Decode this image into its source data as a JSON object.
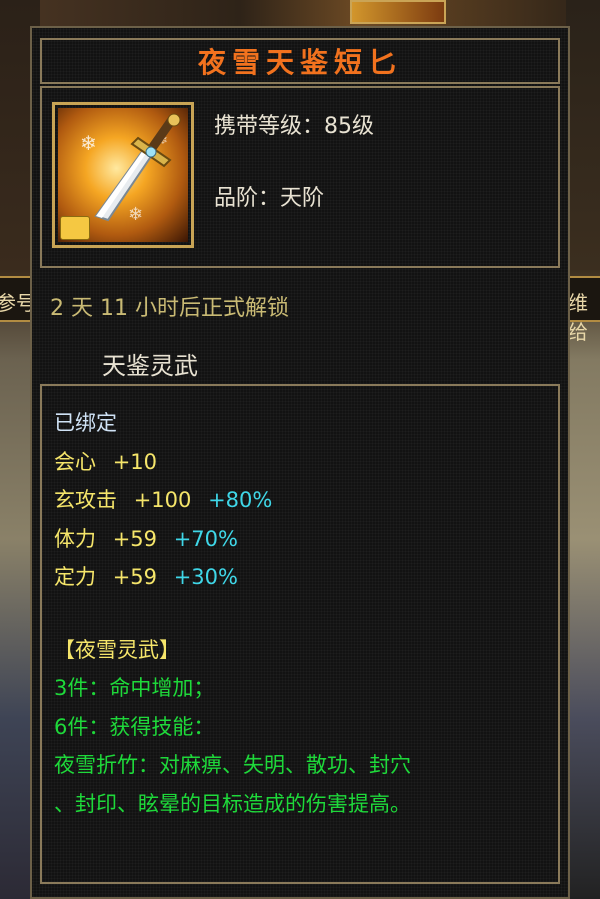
{
  "background": {
    "left_strip_text": "参号",
    "right_strip_text": "维给"
  },
  "item": {
    "name": "夜雪天鉴短匕",
    "icon": "dagger-icon",
    "level_req": "携带等级：85级",
    "grade": "品阶：天阶",
    "unlock": "2 天 11 小时后正式解锁",
    "category": "天鉴灵武"
  },
  "attributes": {
    "bound": "已绑定",
    "stats": [
      {
        "name": "会心",
        "base": "+10",
        "bonus": ""
      },
      {
        "name": "玄攻击",
        "base": "+100",
        "bonus": "+80%"
      },
      {
        "name": "体力",
        "base": "+59",
        "bonus": "+70%"
      },
      {
        "name": "定力",
        "base": "+59",
        "bonus": "+30%"
      }
    ]
  },
  "set": {
    "title": "【夜雪灵武】",
    "lines": [
      "3件：命中增加；",
      "6件：获得技能：",
      "夜雪折竹：对麻痹、失明、散功、封穴",
      "、封印、眩晕的目标造成的伤害提高。"
    ]
  },
  "colors": {
    "title": "#f2721e",
    "stat_label": "#f5e56a",
    "bonus": "#3fd7e8",
    "set_text": "#1ed93a",
    "bound": "#cfe2f5"
  }
}
